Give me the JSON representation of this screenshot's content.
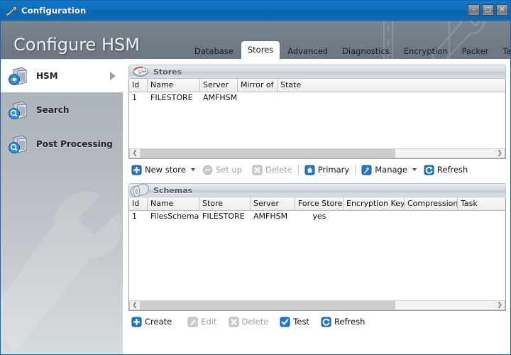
{
  "window": {
    "title": "Configuration",
    "title_icon": "wrench-screwdriver-icon",
    "controls": {
      "minimize": "–",
      "maximize": "□",
      "close": "✕"
    }
  },
  "header": {
    "title": "Configure HSM",
    "watermark_icon": "notebook-wrench-watermark"
  },
  "tabs": [
    {
      "label": "Database",
      "active": false
    },
    {
      "label": "Stores",
      "active": true
    },
    {
      "label": "Advanced",
      "active": false
    },
    {
      "label": "Diagnostics",
      "active": false
    },
    {
      "label": "Encryption",
      "active": false
    },
    {
      "label": "Packer",
      "active": false
    },
    {
      "label": "Tasks",
      "active": false
    }
  ],
  "sidebar": {
    "items": [
      {
        "label": "HSM",
        "icon": "server-hsm-icon",
        "active": true
      },
      {
        "label": "Search",
        "icon": "server-search-icon",
        "active": false
      },
      {
        "label": "Post Processing",
        "icon": "server-search-icon",
        "active": false
      }
    ]
  },
  "stores": {
    "title": "Stores",
    "icon": "disc-icon",
    "columns": [
      "Id",
      "Name",
      "Server",
      "Mirror of",
      "State"
    ],
    "rows": [
      {
        "id": "1",
        "name": "FILESTORE",
        "server": "AMFHSM",
        "mirror_of": "",
        "state": ""
      }
    ],
    "toolbar": [
      {
        "label": "New store",
        "icon": "plus-icon",
        "enabled": true,
        "dropdown": true
      },
      {
        "label": "Set up",
        "icon": "setup-icon",
        "enabled": false,
        "dropdown": false
      },
      {
        "label": "Delete",
        "icon": "cross-icon",
        "enabled": false,
        "dropdown": false
      },
      {
        "label": "Primary",
        "icon": "home-icon",
        "enabled": true,
        "dropdown": false
      },
      {
        "label": "Manage",
        "icon": "wand-icon",
        "enabled": true,
        "dropdown": true
      },
      {
        "label": "Refresh",
        "icon": "refresh-icon",
        "enabled": true,
        "dropdown": false
      }
    ]
  },
  "schemas": {
    "title": "Schemas",
    "icon": "cylinder-icon",
    "columns": [
      "Id",
      "Name",
      "Store",
      "Server",
      "Force Store",
      "Encryption Key",
      "Compression",
      "Task"
    ],
    "rows": [
      {
        "id": "1",
        "name": "FilesSchema",
        "store": "FILESTORE",
        "server": "AMFHSM",
        "force_store": "yes",
        "encryption_key": "",
        "compression": "",
        "task": ""
      }
    ],
    "toolbar": [
      {
        "label": "Create",
        "icon": "plus-icon",
        "enabled": true
      },
      {
        "label": "Edit",
        "icon": "pencil-icon",
        "enabled": false
      },
      {
        "label": "Delete",
        "icon": "cross-icon",
        "enabled": false
      },
      {
        "label": "Test",
        "icon": "check-icon",
        "enabled": true
      },
      {
        "label": "Refresh",
        "icon": "refresh-icon",
        "enabled": true
      }
    ]
  },
  "colors": {
    "titlebar_blue": "#0f6fbd",
    "accent_blue": "#1f78d1",
    "header_grey": "#737d87",
    "panel_white": "#ffffff",
    "disabled_grey": "#a2a2a2"
  }
}
